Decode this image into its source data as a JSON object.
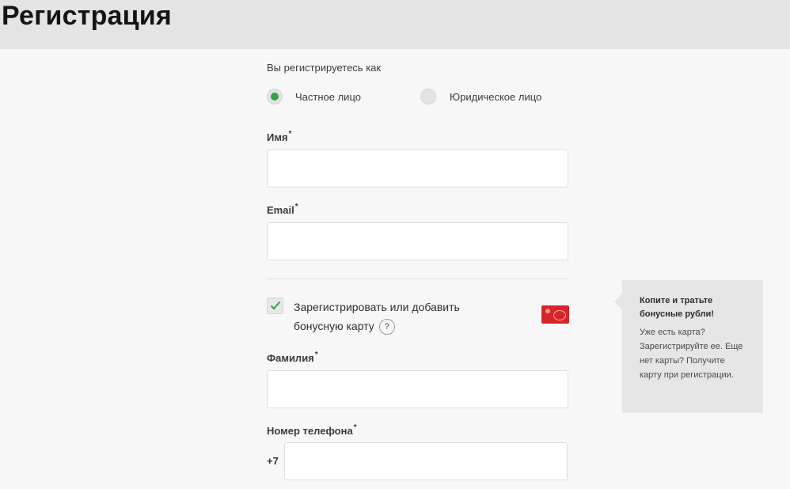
{
  "header": {
    "title": "Регистрация"
  },
  "form": {
    "register_as_label": "Вы регистрируетесь как",
    "account_types": [
      {
        "label": "Частное лицо",
        "selected": true
      },
      {
        "label": "Юридическое лицо",
        "selected": false
      }
    ],
    "first_name": {
      "label": "Имя",
      "required_mark": "*",
      "value": "",
      "placeholder": ""
    },
    "email": {
      "label": "Email",
      "required_mark": "*",
      "value": "",
      "placeholder": ""
    },
    "bonus_card": {
      "checked": true,
      "label_line1": "Зарегистрировать или добавить",
      "label_line2": "бонусную карту",
      "help_symbol": "?"
    },
    "last_name": {
      "label": "Фамилия",
      "required_mark": "*",
      "value": "",
      "placeholder": ""
    },
    "phone": {
      "label": "Номер телефона",
      "required_mark": "*",
      "prefix": "+7",
      "value": "",
      "placeholder": ""
    }
  },
  "tooltip": {
    "title": "Копите и тратьте бонусные рубли!",
    "text": "Уже есть карта? Зарегистрируйте ее. Еще нет карты? Получите карту при регистрации."
  },
  "colors": {
    "header_bg": "#e4e4e4",
    "page_bg": "#f7f7f7",
    "accent_green": "#2fa24a",
    "card_red": "#d8242a",
    "tooltip_bg": "#e6e6e6"
  },
  "icons": {
    "radio_selected": "radio-checked-icon",
    "radio_unselected": "radio-unchecked-icon",
    "checkbox": "checkmark-icon",
    "help": "help-icon",
    "card": "bonus-card-icon"
  }
}
